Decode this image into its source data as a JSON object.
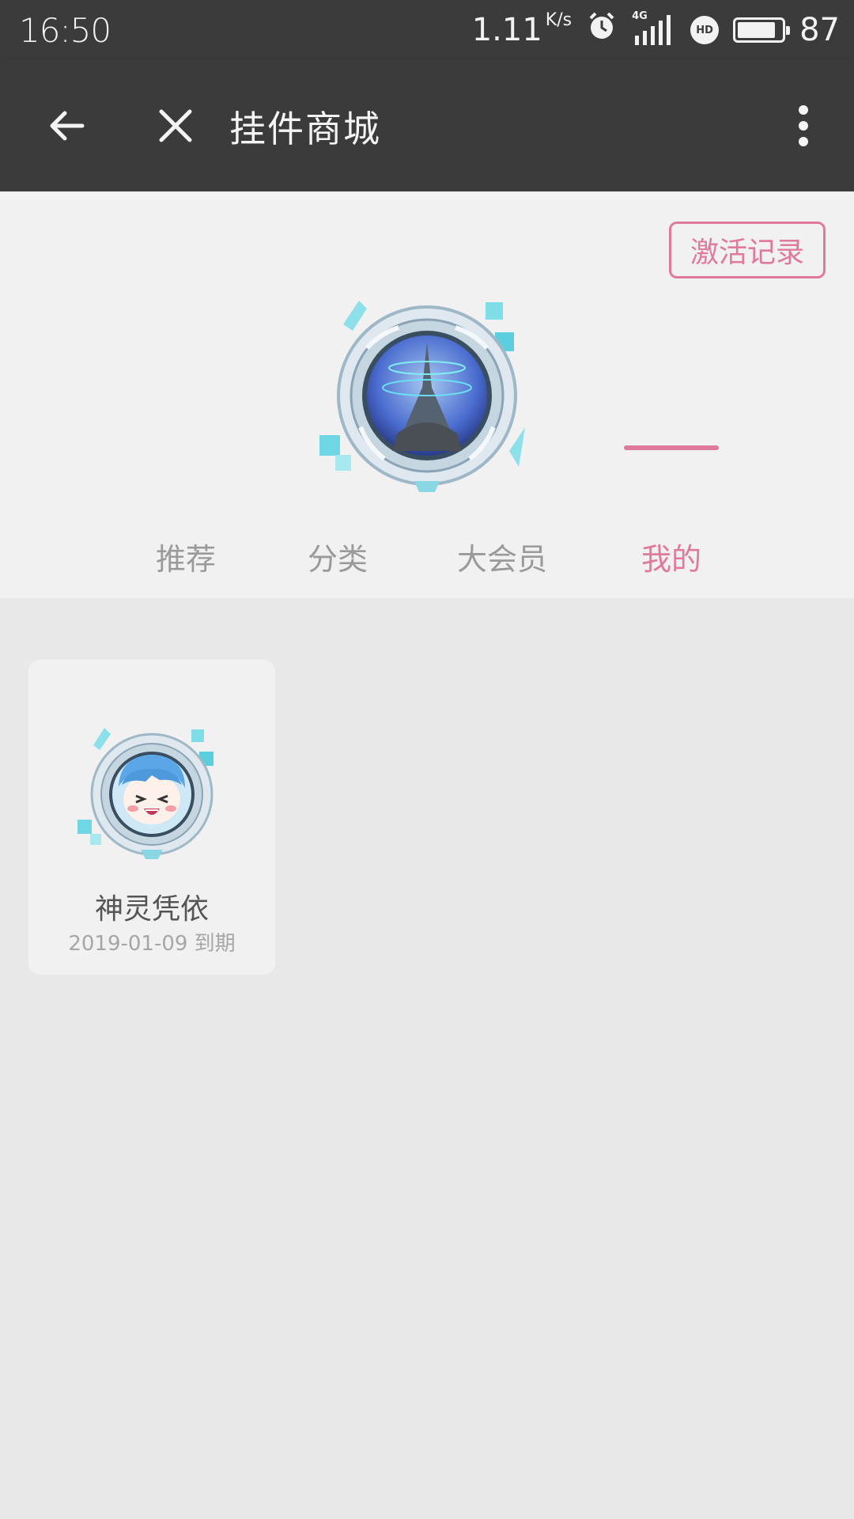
{
  "status_bar": {
    "time": "16:50",
    "network_speed": "1.11",
    "speed_unit": "K/s",
    "battery_level": "87",
    "battery_fraction": 0.87,
    "network_type": "4G",
    "hd_label": "HD",
    "icons": [
      "alarm-icon",
      "signal-icon",
      "hd-call-icon",
      "battery-icon"
    ]
  },
  "toolbar": {
    "title": "挂件商城",
    "back_icon": "back-arrow-icon",
    "close_icon": "close-icon",
    "more_icon": "more-vertical-icon"
  },
  "header": {
    "activate_record_label": "激活记录"
  },
  "tabs": [
    {
      "label": "推荐",
      "active": false
    },
    {
      "label": "分类",
      "active": false
    },
    {
      "label": "大会员",
      "active": false
    },
    {
      "label": "我的",
      "active": true
    }
  ],
  "my_pendants": [
    {
      "name": "神灵凭依",
      "expiry": "2019-01-09 到期"
    }
  ],
  "colors": {
    "accent": "#e07a9a",
    "toolbar_bg": "#3b3b3c",
    "header_bg": "#f1f1f2",
    "content_bg": "#e8e8e9"
  }
}
